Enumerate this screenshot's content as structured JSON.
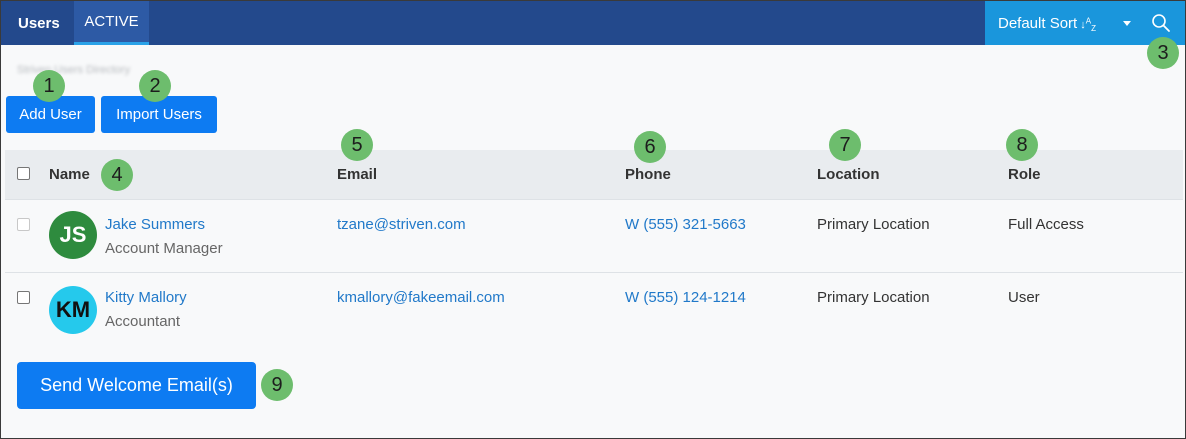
{
  "header": {
    "tab_users": "Users",
    "tab_active": "ACTIVE",
    "sort_label": "Default Sort",
    "sort_icon": "sort-az-icon",
    "search_icon": "search-icon"
  },
  "breadcrumb": "Striven Users  Directory",
  "buttons": {
    "add_user": "Add User",
    "import_users": "Import Users",
    "send_welcome": "Send Welcome Email(s)"
  },
  "badges": [
    "1",
    "2",
    "3",
    "4",
    "5",
    "6",
    "7",
    "8",
    "9"
  ],
  "table": {
    "columns": [
      "Name",
      "Email",
      "Phone",
      "Location",
      "Role"
    ],
    "rows": [
      {
        "initials": "JS",
        "avatar_color": "#2e8b3e",
        "initials_color": "#ffffff",
        "name": "Jake Summers",
        "title": "Account Manager",
        "email": "tzane@striven.com",
        "phone": "W (555) 321-5663",
        "location": "Primary Location",
        "role": "Full Access",
        "checkbox_disabled": true
      },
      {
        "initials": "KM",
        "avatar_color": "#25c9ec",
        "initials_color": "#111111",
        "name": "Kitty Mallory",
        "title": "Accountant",
        "email": "kmallory@fakeemail.com",
        "phone": "W (555) 124-1214",
        "location": "Primary Location",
        "role": "User",
        "checkbox_disabled": false
      }
    ]
  },
  "colors": {
    "topbar": "#23498c",
    "accent": "#0d7bf2",
    "badge": "#6dbd6d",
    "link": "#2179c9"
  }
}
